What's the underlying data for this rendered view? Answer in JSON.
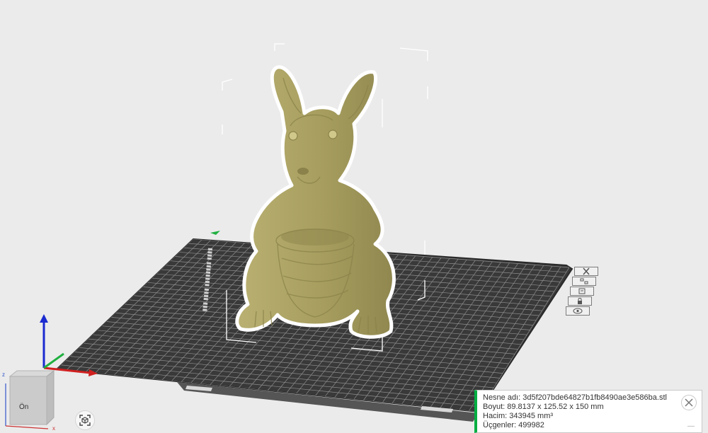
{
  "viewcube": {
    "face_label": "Ön",
    "axis_x": "x",
    "axis_z": "z"
  },
  "object_info": {
    "name": "Nesne adı: 3d5f207bde64827b1fb8490ae3e586ba.stl",
    "size": "Boyut: 89.8137 x 125.52 x 150 mm",
    "volume": "Hacim: 343945 mm³",
    "triangles": "Üçgenler: 499982"
  },
  "colors": {
    "background": "#ebebeb",
    "plate": "#3a3a3a",
    "grid": "#8c8c8c",
    "model": "#a9a062",
    "accent": "#00ae42"
  },
  "plate_tools": [
    "close-icon",
    "auto-arrange-icon",
    "settings-icon",
    "lock-icon",
    "eye-icon"
  ]
}
